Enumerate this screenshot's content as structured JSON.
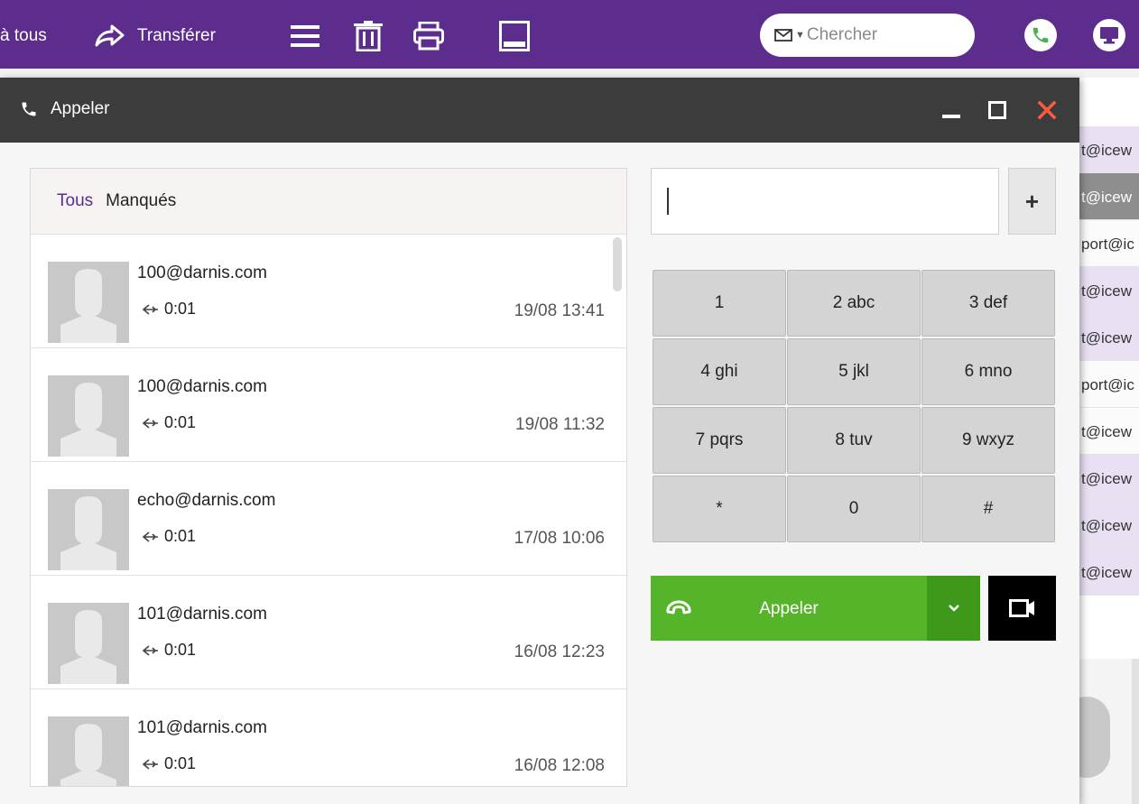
{
  "toolbar": {
    "reply_all_partial": "à tous",
    "forward_label": "Transférer",
    "search_placeholder": "Chercher"
  },
  "background_list": [
    "t@icew",
    "t@icew",
    "port@ic",
    "t@icew",
    "t@icew",
    "port@ic",
    "t@icew",
    "t@icew",
    "t@icew",
    "t@icew"
  ],
  "dialog": {
    "title": "Appeler",
    "tabs": [
      {
        "label": "Tous",
        "active": true
      },
      {
        "label": "Manqués",
        "active": false
      }
    ],
    "calls": [
      {
        "address": "100@darnis.com",
        "duration": "0:01",
        "time": "19/08 13:41"
      },
      {
        "address": "100@darnis.com",
        "duration": "0:01",
        "time": "19/08 11:32"
      },
      {
        "address": "echo@darnis.com",
        "duration": "0:01",
        "time": "17/08 10:06"
      },
      {
        "address": "101@darnis.com",
        "duration": "0:01",
        "time": "16/08 12:23"
      },
      {
        "address": "101@darnis.com",
        "duration": "0:01",
        "time": "16/08 12:08"
      }
    ],
    "number_value": "",
    "plus_label": "+",
    "keypad": [
      "1",
      "2 abc",
      "3 def",
      "4 ghi",
      "5 jkl",
      "6 mno",
      "7 pqrs",
      "8 tuv",
      "9 wxyz",
      "*",
      "0",
      "#"
    ],
    "call_label": "Appeler"
  },
  "colors": {
    "brand_purple": "#5d2d8e",
    "call_green": "#55b42a",
    "call_green_dark": "#3e991a",
    "header_dark": "#3c3c3c",
    "close_red": "#ff5a3c",
    "phone_icon_green": "#4caf50"
  },
  "icons": [
    "forward-icon",
    "menu-icon",
    "trash-icon",
    "print-icon",
    "layout-icon",
    "envelope-icon",
    "phone-icon",
    "screen-share-icon",
    "minimize-icon",
    "maximize-icon",
    "close-icon",
    "reply-arrow-icon",
    "handset-icon",
    "chevron-down-icon",
    "video-icon"
  ]
}
